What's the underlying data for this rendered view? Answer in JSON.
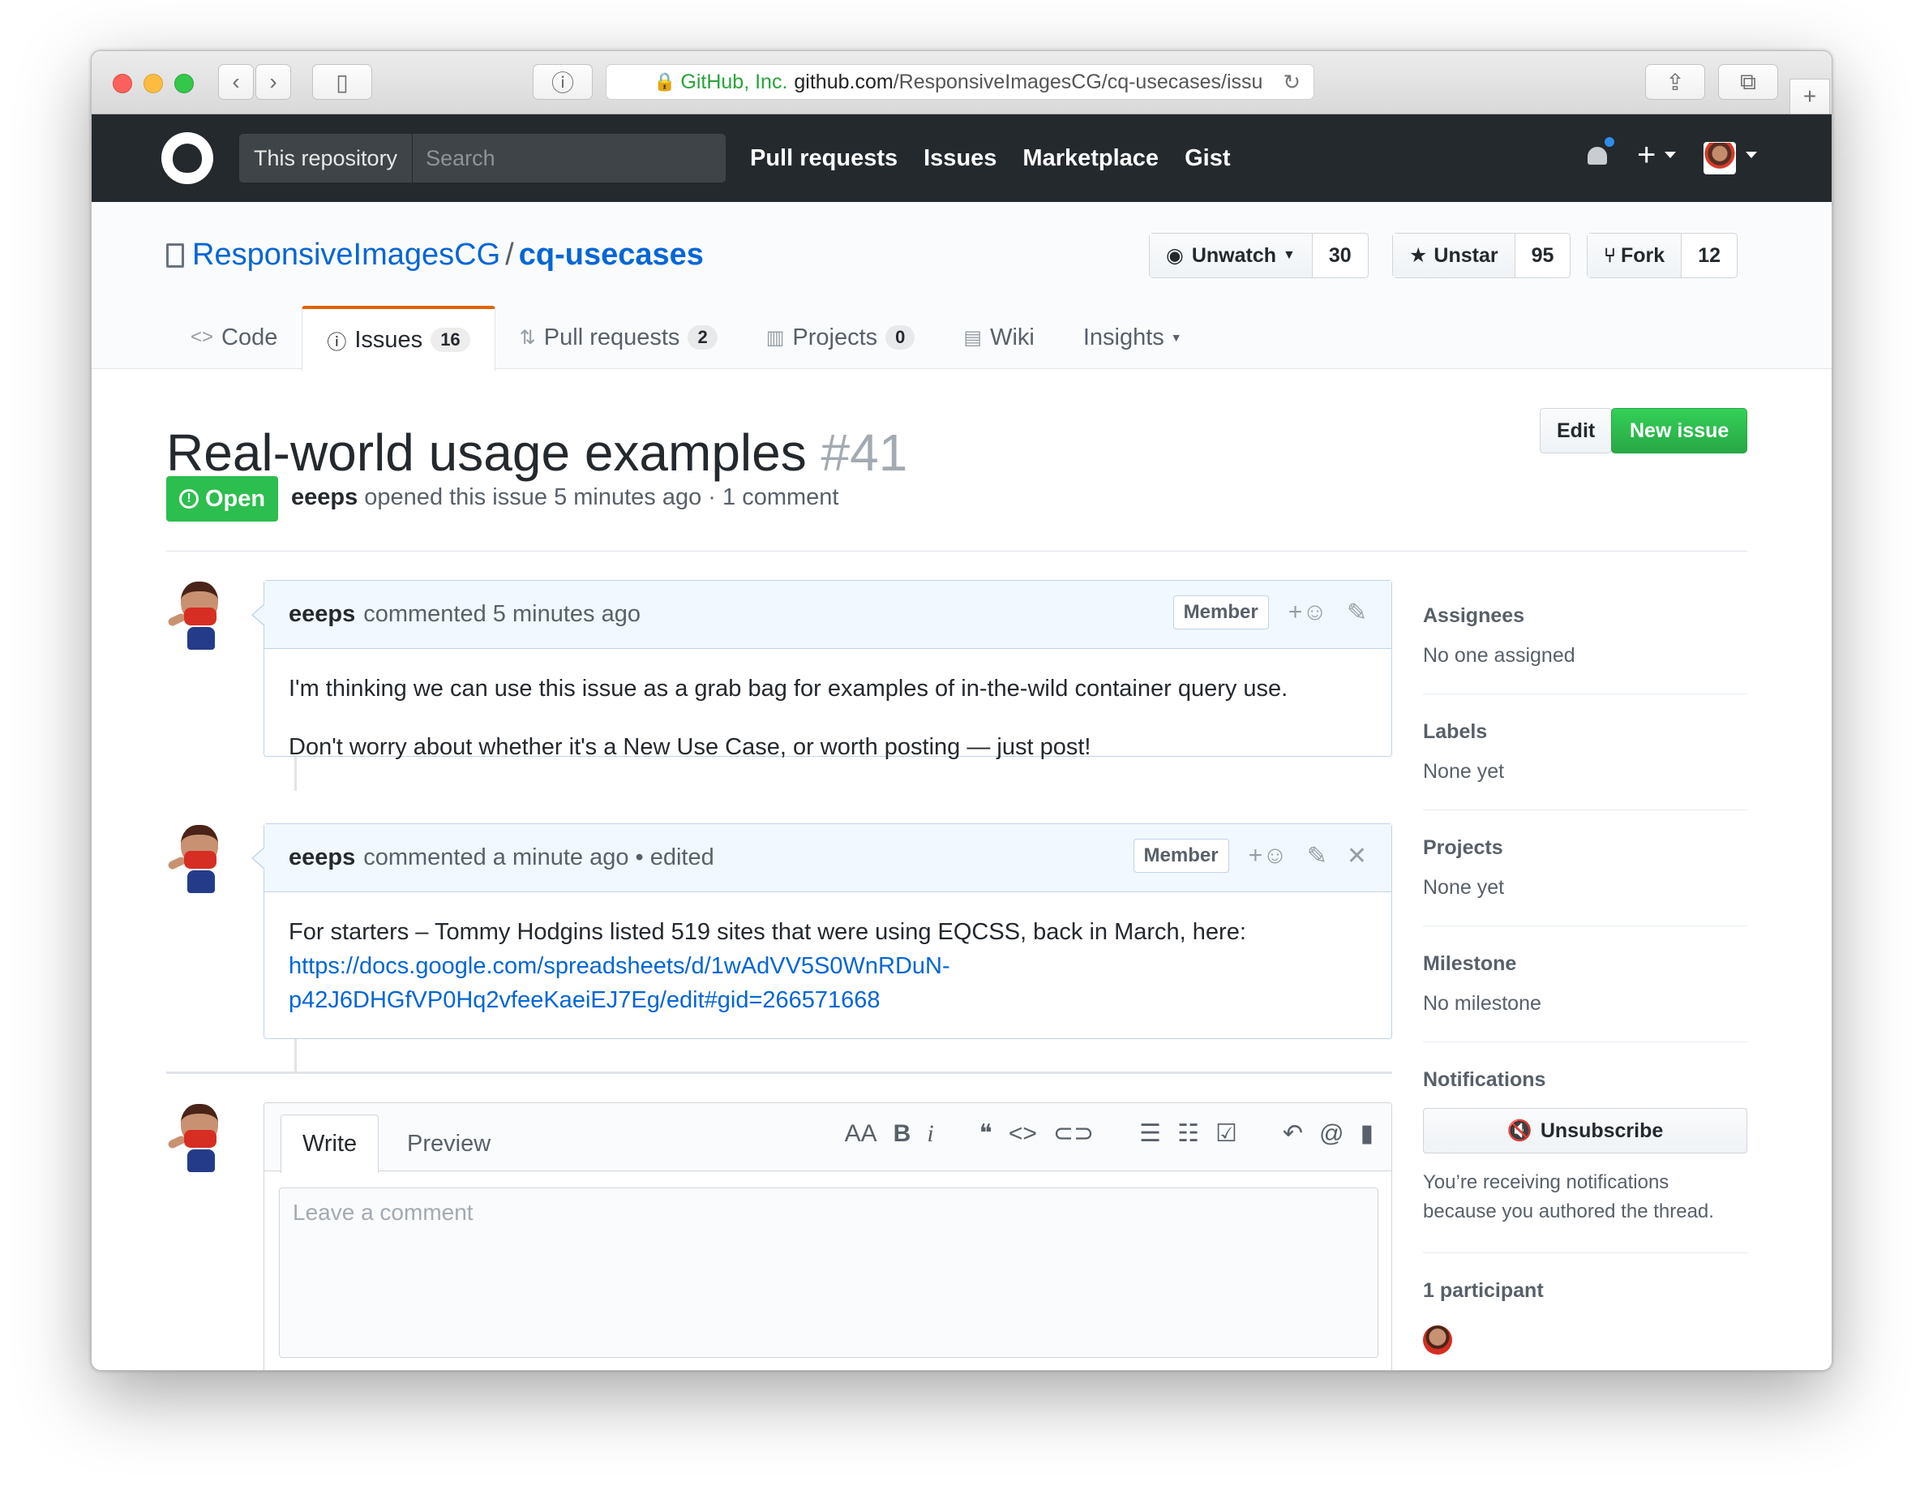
{
  "browser": {
    "address": {
      "org": "GitHub, Inc.",
      "host": "github.com",
      "path": "/ResponsiveImagesCG/cq-usecases/issu"
    }
  },
  "header": {
    "scope_label": "This repository",
    "search_placeholder": "Search",
    "nav": [
      "Pull requests",
      "Issues",
      "Marketplace",
      "Gist"
    ],
    "plus": "+"
  },
  "repo": {
    "owner": "ResponsiveImagesCG",
    "separator": "/",
    "name": "cq-usecases",
    "watch": {
      "label": "Unwatch",
      "count": "30"
    },
    "star": {
      "label": "Unstar",
      "count": "95"
    },
    "fork": {
      "label": "Fork",
      "count": "12"
    },
    "tabs": [
      {
        "label": "Code",
        "icon": "code-icon"
      },
      {
        "label": "Issues",
        "count": "16",
        "icon": "issue-opened-icon"
      },
      {
        "label": "Pull requests",
        "count": "2",
        "icon": "git-pull-request-icon"
      },
      {
        "label": "Projects",
        "count": "0",
        "icon": "project-icon"
      },
      {
        "label": "Wiki",
        "icon": "book-icon"
      },
      {
        "label": "Insights",
        "icon": "caret-down-icon"
      }
    ]
  },
  "issue": {
    "title": "Real-world usage examples",
    "number": "#41",
    "edit_label": "Edit",
    "new_issue_label": "New issue",
    "state": "Open",
    "author": "eeeps",
    "meta_text": "opened this issue 5 minutes ago · 1 comment"
  },
  "comments": [
    {
      "author": "eeeps",
      "time_text": "commented 5 minutes ago",
      "role": "Member",
      "paragraphs": [
        "I'm thinking we can use this issue as a grab bag for examples of in-the-wild container query use.",
        "Don't worry about whether it's a New Use Case, or worth posting — just post!"
      ]
    },
    {
      "author": "eeeps",
      "time_text": "commented a minute ago",
      "edited": "• edited",
      "role": "Member",
      "text": "For starters – Tommy Hodgins listed 519 sites that were using EQCSS, back in March, here:",
      "link_line1": "https://docs.google.com/spreadsheets/d/1wAdVV5S0WnRDuN-",
      "link_line2": "p42J6DHGfVP0Hq2vfeeKaeiEJ7Eg/edit#gid=266571668"
    }
  ],
  "composer": {
    "write_tab": "Write",
    "preview_tab": "Preview",
    "placeholder": "Leave a comment",
    "toolbar": {
      "heading": "AA",
      "bold": "B",
      "italic": "i",
      "quote": "❝",
      "code": "<>",
      "mention": "@"
    }
  },
  "sidebar": {
    "assignees": {
      "heading": "Assignees",
      "value": "No one assigned"
    },
    "labels": {
      "heading": "Labels",
      "value": "None yet"
    },
    "projects": {
      "heading": "Projects",
      "value": "None yet"
    },
    "milestone": {
      "heading": "Milestone",
      "value": "No milestone"
    },
    "notifications": {
      "heading": "Notifications",
      "button": "Unsubscribe",
      "reason": "You’re receiving notifications because you authored the thread."
    },
    "participants": {
      "heading": "1 participant"
    }
  },
  "colors": {
    "header_bg": "#24292e",
    "link": "#0366d6",
    "open_state": "#2cbe4e",
    "new_issue": "#28a745",
    "selected_tab_accent": "#e36209",
    "comment_head_bg": "#f1f8ff"
  }
}
